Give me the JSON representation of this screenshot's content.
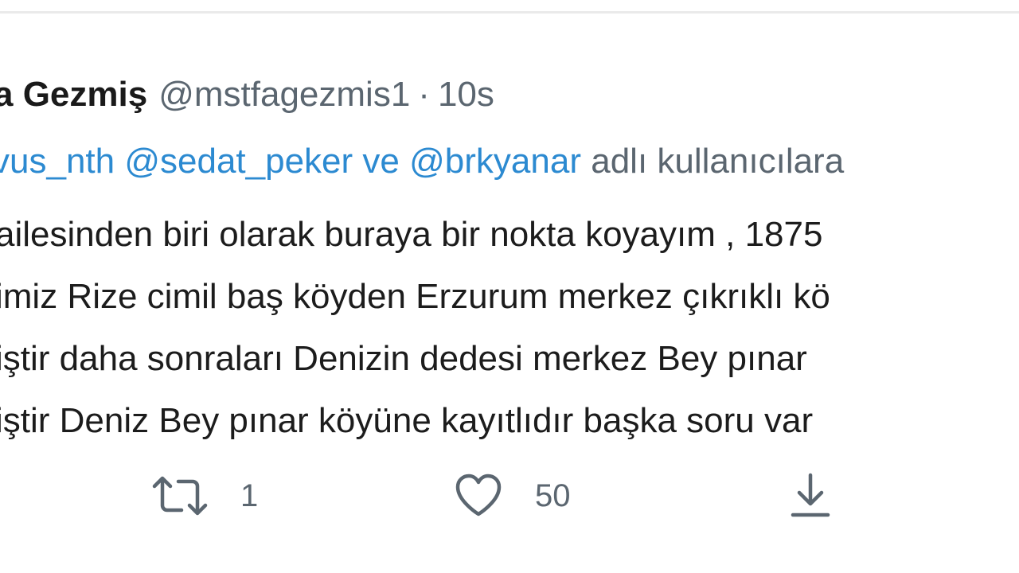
{
  "tweet": {
    "display_name": "a Gezmiş",
    "handle": "@mstfagezmis1",
    "separator": "·",
    "time": "10s",
    "reply_to": {
      "prefix": "vus_nth",
      "mention_2": "@sedat_peker",
      "conjunction": "ve",
      "mention_3": "@brkyanar",
      "suffix": "adlı kullanıcılara"
    },
    "body_lines": [
      "ailesinden biri olarak buraya bir nokta koyayım , 1875",
      "imiz Rize cimil baş köyden Erzurum merkez çıkrıklı kö",
      "iştir daha sonraları Denizin dedesi merkez Bey pınar",
      "iştir Deniz Bey pınar köyüne kayıtlıdır başka soru var"
    ],
    "actions": {
      "retweet_count": "1",
      "like_count": "50",
      "share_count": ""
    }
  },
  "colors": {
    "link": "#2c8ad1",
    "muted": "#5b6670",
    "text": "#1c1c1c"
  },
  "icons": [
    "retweet-icon",
    "heart-icon",
    "share-icon"
  ]
}
